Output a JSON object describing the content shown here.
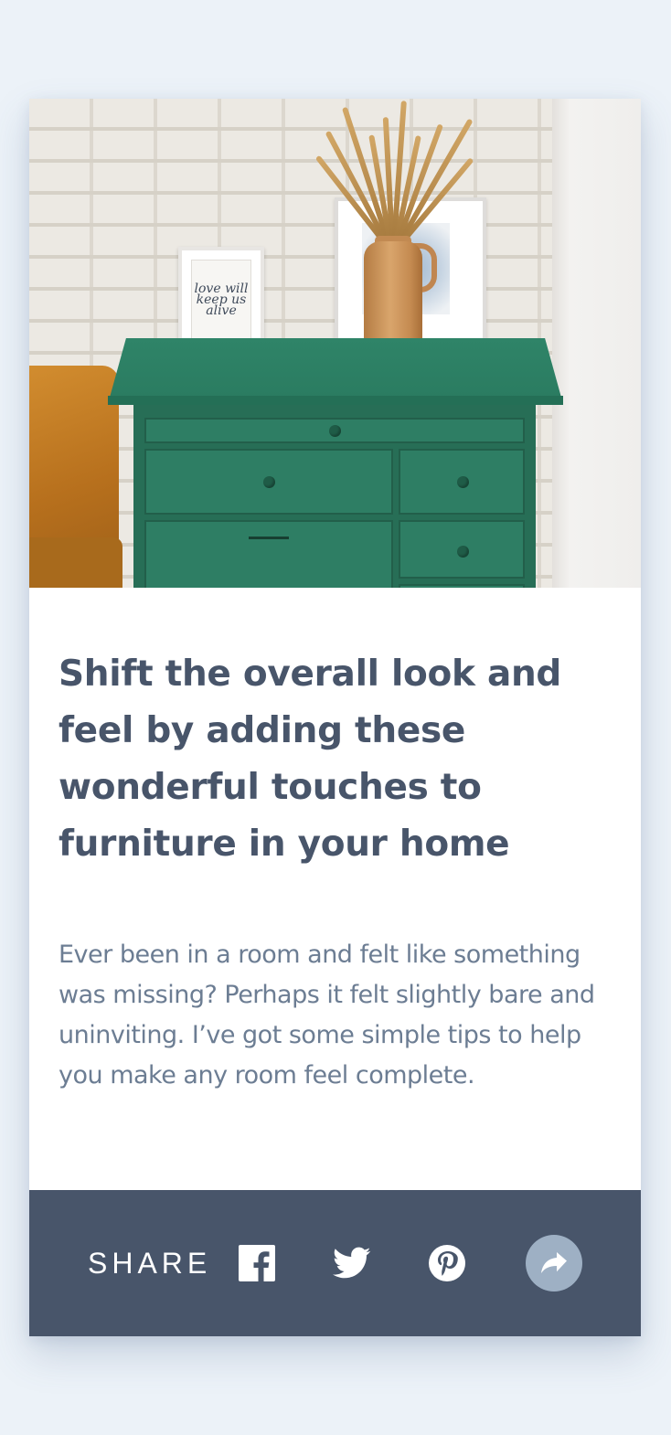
{
  "article": {
    "title": "Shift the overall look and feel by adding these wonderful touches to furniture in your home",
    "excerpt": "Ever been in a room and felt like something was missing? Perhaps it felt slightly bare and uninviting. I’ve got some simple tips to help you make any room feel complete."
  },
  "image": {
    "frame_text": "love will keep us alive"
  },
  "share": {
    "label": "SHARE",
    "buttons": [
      {
        "name": "facebook",
        "icon": "facebook-icon"
      },
      {
        "name": "twitter",
        "icon": "twitter-icon"
      },
      {
        "name": "pinterest",
        "icon": "pinterest-icon"
      },
      {
        "name": "more",
        "icon": "share-arrow-icon"
      }
    ]
  },
  "colors": {
    "page_background": "#ecf2f8",
    "title": "#48556a",
    "body_text": "#6c7d93",
    "share_bar": "#48556a",
    "share_more_button": "#9eb0c4"
  }
}
